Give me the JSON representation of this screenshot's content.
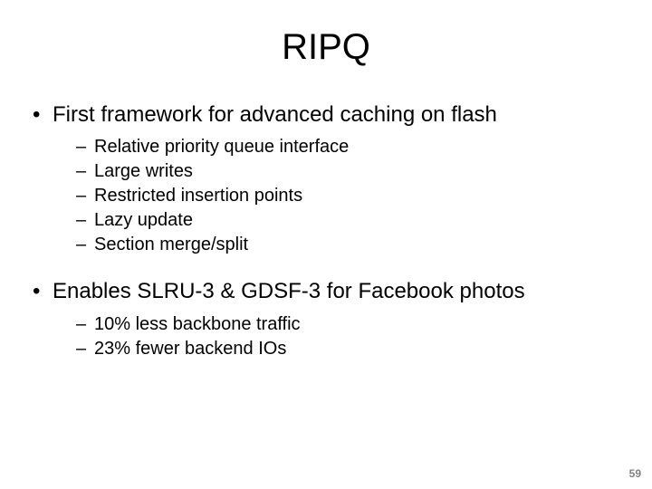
{
  "title": "RIPQ",
  "bullets": [
    {
      "text": "First framework for advanced caching on flash",
      "sub": [
        "Relative priority queue interface",
        "Large writes",
        "Restricted insertion points",
        "Lazy update",
        "Section merge/split"
      ]
    },
    {
      "text": "Enables SLRU-3 & GDSF-3 for Facebook photos",
      "sub": [
        "10% less backbone traffic",
        "23% fewer backend IOs"
      ]
    }
  ],
  "page_number": "59"
}
